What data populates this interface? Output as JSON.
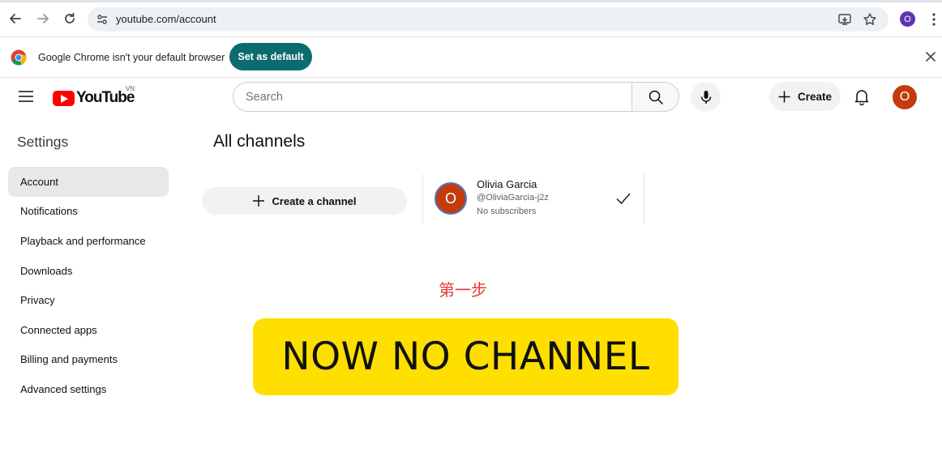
{
  "browser": {
    "url": "youtube.com/account",
    "profile_initial": "O"
  },
  "infobar": {
    "message": "Google Chrome isn't your default browser",
    "set_default_label": "Set as default"
  },
  "header": {
    "logo_text": "YouTube",
    "country_code": "VN",
    "search_placeholder": "Search",
    "create_label": "Create",
    "avatar_initial": "O"
  },
  "sidebar": {
    "title": "Settings",
    "items": [
      {
        "label": "Account",
        "active": true
      },
      {
        "label": "Notifications"
      },
      {
        "label": "Playback and performance"
      },
      {
        "label": "Downloads"
      },
      {
        "label": "Privacy"
      },
      {
        "label": "Connected apps"
      },
      {
        "label": "Billing and payments"
      },
      {
        "label": "Advanced settings"
      }
    ]
  },
  "main": {
    "title": "All channels",
    "create_channel_label": "Create a channel",
    "channel": {
      "initial": "O",
      "name": "Olivia Garcia",
      "handle": "@OliviaGarcia-j2z",
      "subscribers": "No subscribers"
    }
  },
  "overlay": {
    "step_text": "第一步",
    "banner_text": "NOW NO CHANNEL"
  },
  "colors": {
    "accent_teal": "#0b6b71",
    "youtube_red": "#ff0000",
    "avatar_orange": "#c43b0c",
    "banner_yellow": "#ffdf00",
    "step_red": "#e53935"
  }
}
